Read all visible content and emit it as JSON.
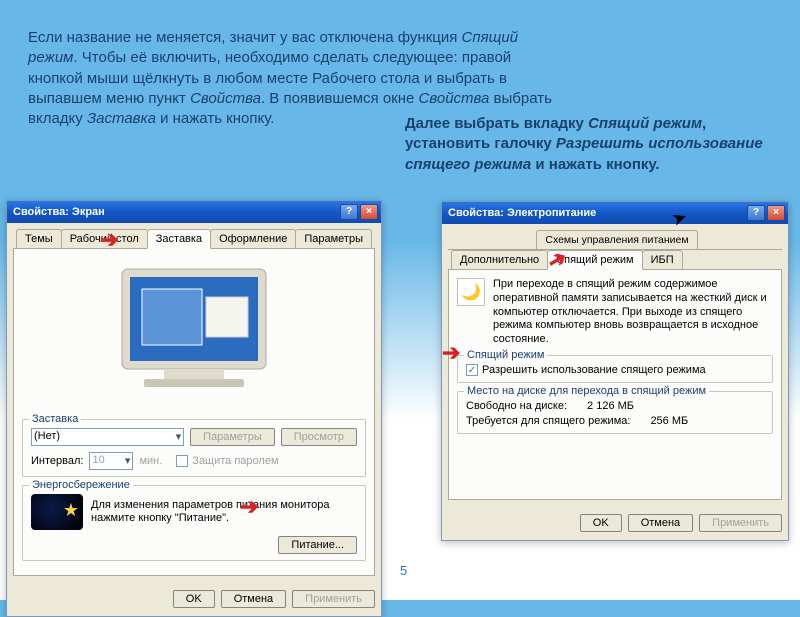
{
  "intro": {
    "p1a": "Если название не меняется, значит у вас отключена функция ",
    "p1em1": "Спящий режим",
    "p1b": ". Чтобы её включить, необходимо сделать следующее: правой кнопкой мыши щёлкнуть в любом месте Рабочего стола и выбрать в выпавшем меню пункт ",
    "p1em2": "Свойства",
    "p1c": ". В появившемся окне ",
    "p1em3": "Свойства",
    "p1d": " выбрать вкладку ",
    "p1em4": "Заставка",
    "p1e": " и нажать кнопку."
  },
  "side": {
    "a": "Далее выбрать вкладку ",
    "em1": "Спящий режим",
    "b": ", установить галочку ",
    "em2": "Разрешить использование спящего режима",
    "c": " и нажать кнопку."
  },
  "page_num": "5",
  "win1": {
    "title": "Свойства: Экран",
    "help": "?",
    "close": "×",
    "tabs": {
      "t1": "Темы",
      "t2": "Рабочий стол",
      "t3": "Заставка",
      "t4": "Оформление",
      "t5": "Параметры"
    },
    "screensaver_label": "Заставка",
    "screensaver_value": "(Нет)",
    "btn_params": "Параметры",
    "btn_preview": "Просмотр",
    "interval_label": "Интервал:",
    "interval_value": "10",
    "interval_unit": "мин.",
    "protect": "Защита паролем",
    "energy_legend": "Энергосбережение",
    "energy_text": "Для изменения параметров питания монитора нажмите кнопку \"Питание\".",
    "btn_power": "Питание...",
    "btn_ok": "OK",
    "btn_cancel": "Отмена",
    "btn_apply": "Применить"
  },
  "win2": {
    "title": "Свойства: Электропитание",
    "help": "?",
    "close": "×",
    "tabs_row1": {
      "t1": "Схемы управления питанием"
    },
    "tabs_row2": {
      "t1": "Дополнительно",
      "t2": "Спящий режим",
      "t3": "ИБП"
    },
    "info_text": "При переходе в спящий режим содержимое оперативной памяти записывается на жесткий диск и компьютер отключается. При выходе из спящего режима компьютер вновь возвращается в исходное состояние.",
    "sleep_legend": "Спящий режим",
    "allow_label": "Разрешить использование спящего режима",
    "disk_legend": "Место на диске для перехода в спящий режим",
    "free_label": "Свободно на диске:",
    "free_value": "2 126 МБ",
    "need_label": "Требуется для спящего режима:",
    "need_value": "256 МБ",
    "btn_ok": "OK",
    "btn_cancel": "Отмена",
    "btn_apply": "Применить"
  }
}
